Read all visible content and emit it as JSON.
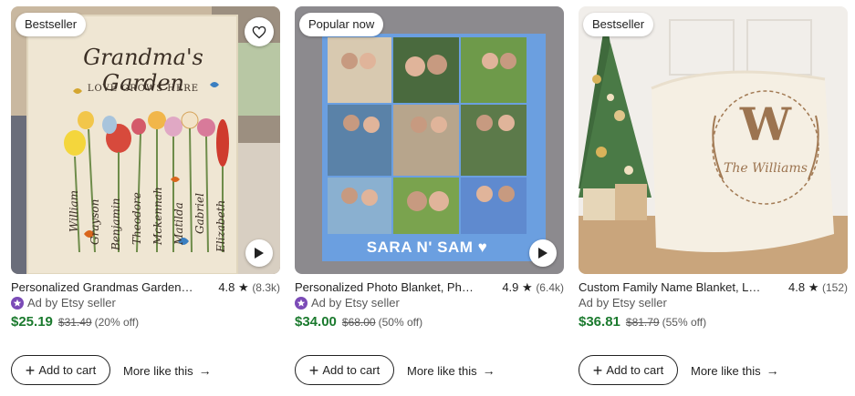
{
  "listings": [
    {
      "badge": "Bestseller",
      "title": "Personalized Grandmas Garden Blanket, Custom Birth Flower Blanket",
      "rating": "4.8",
      "review_count": "(8.3k)",
      "ad_text": "Ad by Etsy seller",
      "price": "$25.19",
      "original_price": "$31.49",
      "discount": "(20% off)",
      "cart_label": "Add to cart",
      "more_label": "More like this",
      "image_text": {
        "headline": "Grandma's Garden",
        "subline": "LOVE GROWS HERE",
        "names": [
          "William",
          "Grayson",
          "Benjamin",
          "Theodore",
          "Mckennah",
          "Matilda",
          "Gabriel",
          "Elizabeth"
        ]
      }
    },
    {
      "badge": "Popular now",
      "title": "Personalized Photo Blanket, Photo Collage Blanket",
      "rating": "4.9",
      "review_count": "(6.4k)",
      "ad_text": "Ad by Etsy seller",
      "price": "$34.00",
      "original_price": "$68.00",
      "discount": "(50% off)",
      "cart_label": "Add to cart",
      "more_label": "More like this",
      "image_text": {
        "caption": "SARA N' SAM ♥"
      }
    },
    {
      "badge": "Bestseller",
      "title": "Custom Family Name Blanket, Last Name Monogram Blanket",
      "rating": "4.8",
      "review_count": "(152)",
      "ad_text": "Ad by Etsy seller",
      "price": "$36.81",
      "original_price": "$81.79",
      "discount": "(55% off)",
      "cart_label": "Add to cart",
      "more_label": "More like this",
      "image_text": {
        "monogram": "W",
        "family": "The Williams"
      }
    }
  ],
  "icons": {
    "favorite": "heart-outline-icon",
    "play": "play-icon",
    "star": "star-icon",
    "ad_badge": "star-seller-icon",
    "plus": "plus-icon",
    "arrow": "arrow-right-icon"
  },
  "colors": {
    "sale_price": "#1b7a2e",
    "ad_badge": "#7b4bb7",
    "photo_blanket_blue": "#6b9fe0"
  }
}
